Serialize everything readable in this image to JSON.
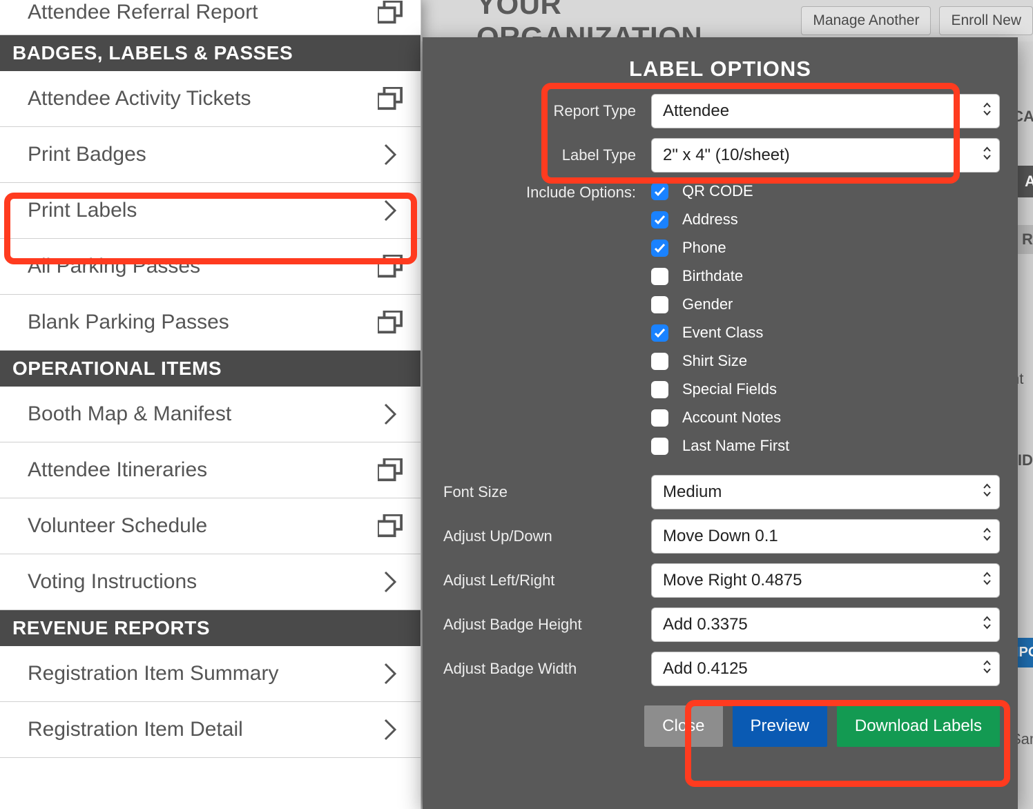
{
  "background": {
    "org_title": "YOUR ORGANIZATION",
    "manage_btn": "Manage Another",
    "enroll_btn": "Enroll New",
    "right_chips": [
      "ICATIO",
      "AR",
      "Re",
      "nt",
      "UIDD",
      "IPORT",
      "Sam"
    ]
  },
  "sidebar": {
    "partial_top": "Attendee Referral Report",
    "sections": [
      {
        "header": "BADGES, LABELS & PASSES",
        "items": [
          {
            "label": "Attendee Activity Tickets",
            "icon": "stack"
          },
          {
            "label": "Print Badges",
            "icon": "chevron"
          },
          {
            "label": "Print Labels",
            "icon": "chevron",
            "highlight": true
          },
          {
            "label": "All Parking Passes",
            "icon": "stack"
          },
          {
            "label": "Blank Parking Passes",
            "icon": "stack"
          }
        ]
      },
      {
        "header": "OPERATIONAL ITEMS",
        "items": [
          {
            "label": "Booth Map & Manifest",
            "icon": "chevron"
          },
          {
            "label": "Attendee Itineraries",
            "icon": "stack"
          },
          {
            "label": "Volunteer Schedule",
            "icon": "stack"
          },
          {
            "label": "Voting Instructions",
            "icon": "chevron"
          }
        ]
      },
      {
        "header": "REVENUE REPORTS",
        "items": [
          {
            "label": "Registration Item Summary",
            "icon": "chevron"
          },
          {
            "label": "Registration Item Detail",
            "icon": "chevron"
          }
        ]
      }
    ]
  },
  "modal": {
    "title": "LABEL OPTIONS",
    "report_type_label": "Report Type",
    "report_type_value": "Attendee",
    "label_type_label": "Label Type",
    "label_type_value": "2\" x 4\" (10/sheet)",
    "include_label": "Include Options:",
    "includes": [
      {
        "label": "QR CODE",
        "checked": true
      },
      {
        "label": "Address",
        "checked": true
      },
      {
        "label": "Phone",
        "checked": true
      },
      {
        "label": "Birthdate",
        "checked": false
      },
      {
        "label": "Gender",
        "checked": false
      },
      {
        "label": "Event Class",
        "checked": true
      },
      {
        "label": "Shirt Size",
        "checked": false
      },
      {
        "label": "Special Fields",
        "checked": false
      },
      {
        "label": "Account Notes",
        "checked": false
      },
      {
        "label": "Last Name First",
        "checked": false
      }
    ],
    "font_size_label": "Font Size",
    "font_size_value": "Medium",
    "adjust_ud_label": "Adjust Up/Down",
    "adjust_ud_value": "Move Down 0.1",
    "adjust_lr_label": "Adjust Left/Right",
    "adjust_lr_value": "Move Right 0.4875",
    "adjust_h_label": "Adjust Badge Height",
    "adjust_h_value": "Add 0.3375",
    "adjust_w_label": "Adjust Badge Width",
    "adjust_w_value": "Add 0.4125",
    "close_btn": "Close",
    "preview_btn": "Preview",
    "download_btn": "Download Labels"
  }
}
